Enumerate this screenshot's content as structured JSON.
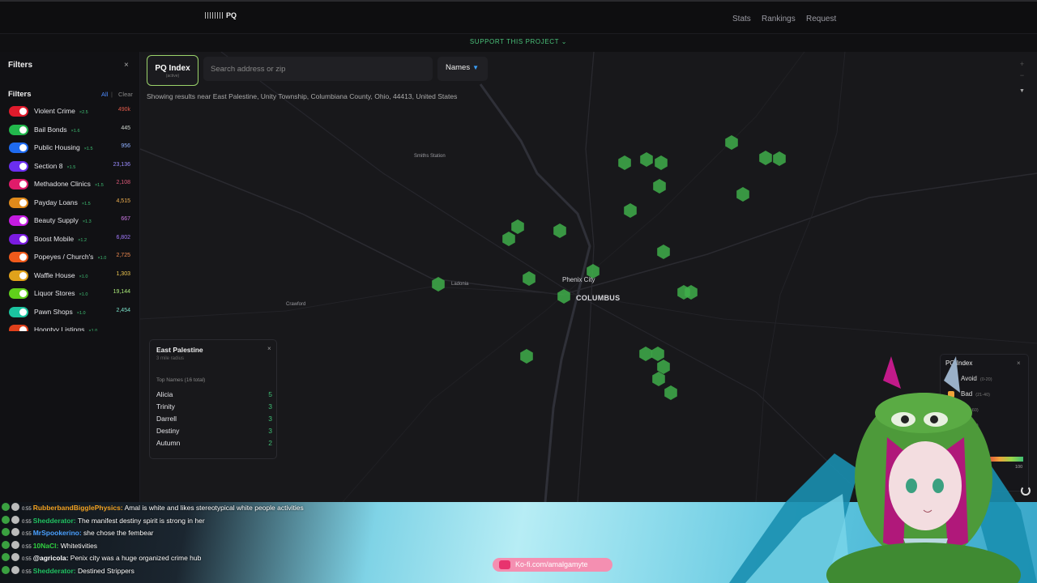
{
  "app": {
    "logo_text": "PQ",
    "nav": [
      "Stats",
      "Rankings",
      "Request"
    ],
    "support_banner": "SUPPORT THIS PROJECT ⌄"
  },
  "sidebar": {
    "header": "Filters",
    "close": "×",
    "section_title": "Filters",
    "all_label": "All",
    "separator": "|",
    "clear_label": "Clear",
    "filters": [
      {
        "name": "Violent Crime",
        "mult": "×2.5",
        "count": "490k",
        "color": "#e01b2c",
        "count_color": "#e05a4a"
      },
      {
        "name": "Bail Bonds",
        "mult": "×1.6",
        "count": "445",
        "color": "#22b84c",
        "count_color": "#cfd6cf"
      },
      {
        "name": "Public Housing",
        "mult": "×1.5",
        "count": "956",
        "color": "#1f6bf0",
        "count_color": "#8fb0ff"
      },
      {
        "name": "Section 8",
        "mult": "×1.5",
        "count": "23,136",
        "color": "#6b2ef0",
        "count_color": "#9b8cff"
      },
      {
        "name": "Methadone Clinics",
        "mult": "×1.5",
        "count": "2,108",
        "color": "#e01b6a",
        "count_color": "#e05a7a"
      },
      {
        "name": "Payday Loans",
        "mult": "×1.5",
        "count": "4,515",
        "color": "#e08a1b",
        "count_color": "#f0b050"
      },
      {
        "name": "Beauty Supply",
        "mult": "×1.3",
        "count": "667",
        "color": "#c41be0",
        "count_color": "#d07ae8"
      },
      {
        "name": "Boost Mobile",
        "mult": "×1.2",
        "count": "6,802",
        "color": "#7a1be0",
        "count_color": "#a47aff"
      },
      {
        "name": "Popeyes / Church's",
        "mult": "×1.0",
        "count": "2,725",
        "color": "#f05a1b",
        "count_color": "#f08a50"
      },
      {
        "name": "Waffle House",
        "mult": "×1.0",
        "count": "1,303",
        "color": "#e0a21b",
        "count_color": "#f0c850"
      },
      {
        "name": "Liquor Stores",
        "mult": "×1.0",
        "count": "19,144",
        "color": "#60d01b",
        "count_color": "#a8e878"
      },
      {
        "name": "Pawn Shops",
        "mult": "×1.0",
        "count": "2,454",
        "color": "#1bc4a0",
        "count_color": "#7ae0c8"
      },
      {
        "name": "Hooptyy Listings",
        "mult": "×1.0",
        "count": "",
        "color": "#e0401b",
        "count_color": "#888888"
      }
    ]
  },
  "toolbar": {
    "pq_label": "PQ Index",
    "pq_sub": "(active)",
    "search_placeholder": "Search address or zip",
    "names_label": "Names",
    "names_caret": "▼"
  },
  "map": {
    "results_text": "Showing results near East Palestine, Unity Township, Columbiana County, Ohio, 44413, United States",
    "zoom_in": "+",
    "zoom_out": "−",
    "compass": "▼",
    "labels": [
      {
        "key": "smiths",
        "text": "Smiths Station"
      },
      {
        "key": "ladonia",
        "text": "Ladonia"
      },
      {
        "key": "crawford",
        "text": "Crawford"
      },
      {
        "key": "phenix",
        "text": "Phenix City"
      },
      {
        "key": "columbus",
        "text": "COLUMBUS"
      }
    ]
  },
  "card": {
    "title": "East Palestine",
    "subtitle": "3 mile radius",
    "close": "×",
    "top_names_label": "Top Names (16 total)",
    "names": [
      {
        "name": "Alicia",
        "count": "5"
      },
      {
        "name": "Trinity",
        "count": "3"
      },
      {
        "name": "Darrell",
        "count": "3"
      },
      {
        "name": "Destiny",
        "count": "3"
      },
      {
        "name": "Autumn",
        "count": "2"
      }
    ]
  },
  "legend": {
    "title": "PQ Index",
    "close": "×",
    "rows": [
      {
        "label": "Avoid",
        "range": "(0-20)",
        "color": "#e04a3a"
      },
      {
        "label": "Bad",
        "range": "(21-40)",
        "color": "#f0a33a"
      },
      {
        "label": "",
        "range": "(41-60)",
        "color": "#d8d040"
      },
      {
        "label": "",
        "range": "(61-80)",
        "color": "#9ad64a"
      },
      {
        "label": "",
        "range": "(81-100)",
        "color": "#3fbf74"
      }
    ],
    "max": "100"
  },
  "chat": [
    {
      "time": "0:55",
      "user": "RubberbandBigglePhysics:",
      "user_color": "#f0a020",
      "msg": "Amal is white and likes stereotypical white people activities"
    },
    {
      "time": "0:55",
      "user": "Shedderator:",
      "user_color": "#20c060",
      "msg": "The manifest destiny spirit is strong in her"
    },
    {
      "time": "0:55",
      "user": "MrSpookerino:",
      "user_color": "#4aa0ff",
      "msg": "she chose the fembear"
    },
    {
      "time": "0:55",
      "user": "10NaCl:",
      "user_color": "#30d040",
      "msg": "Whitetivities"
    },
    {
      "time": "0:55",
      "user": "@agricola:",
      "user_color": "#ffffff",
      "msg": "Penix city was a huge organized crime hub"
    },
    {
      "time": "0:55",
      "user": "Shedderator:",
      "user_color": "#20c060",
      "msg": "Destined Strippers"
    }
  ],
  "kofi": {
    "text": "Ko-fi.com/amalgamyte"
  }
}
